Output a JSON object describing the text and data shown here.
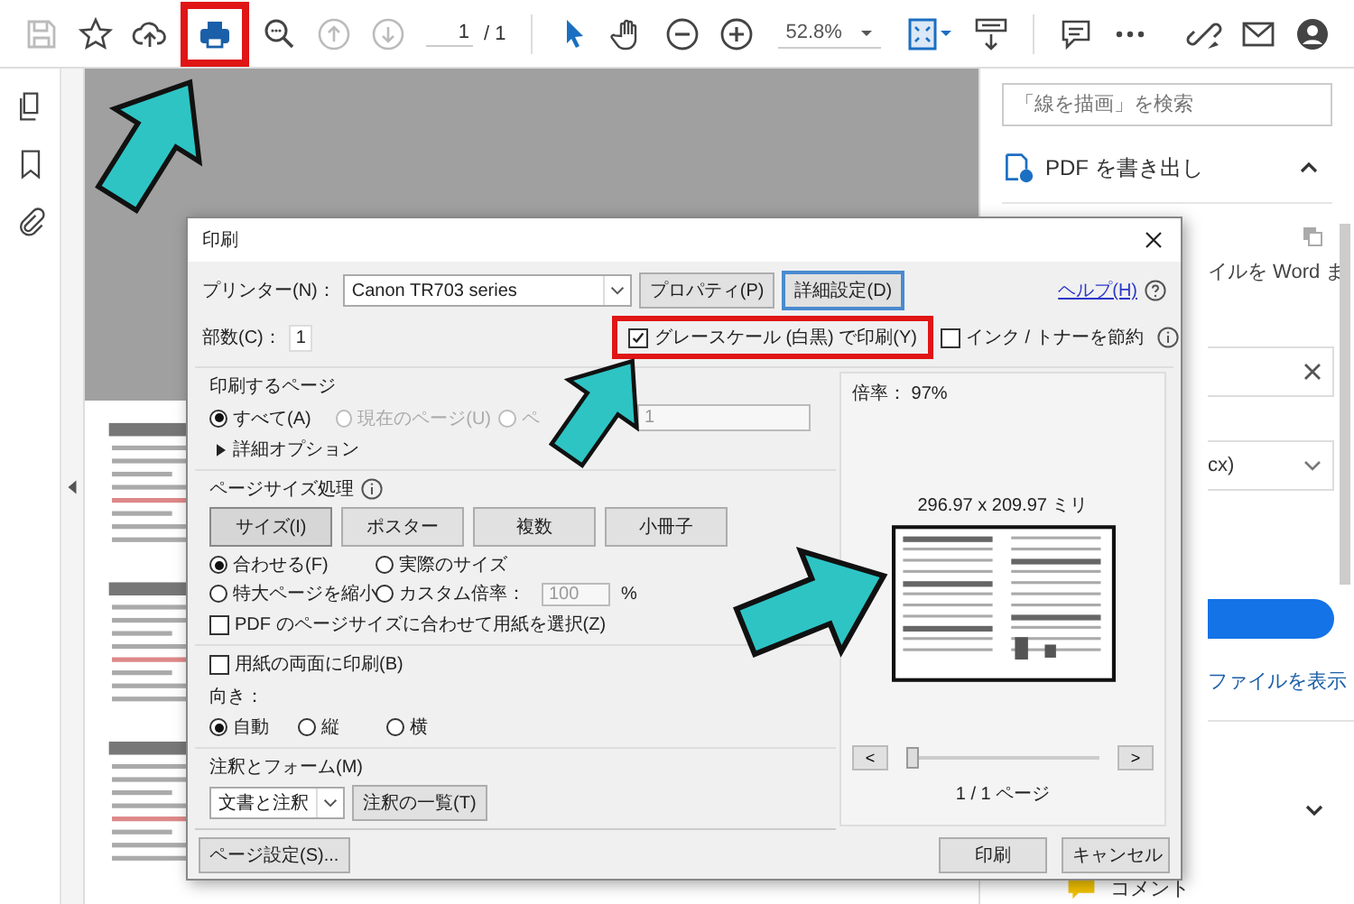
{
  "toolbar": {
    "print_highlighted": true,
    "page_current": "1",
    "page_total": "/ 1",
    "zoom": "52.8%"
  },
  "right_panel": {
    "search_placeholder": "「線を描画」を検索",
    "export_title": "PDF を書き出し",
    "description": "イルを Word ま",
    "format_value": "cx)",
    "view_link": "ファイルを表示",
    "comment_label": "コメント"
  },
  "dialog": {
    "title": "印刷",
    "printer_label": "プリンター(N)：",
    "printer_value": "Canon TR703 series",
    "properties_button": "プロパティ(P)",
    "advanced_button": "詳細設定(D)",
    "help_link": "ヘルプ(H)",
    "copies_label": "部数(C)：",
    "copies_value": "1",
    "grayscale": {
      "label": "グレースケール (白黒) で印刷(Y)",
      "checked": true,
      "highlighted": true
    },
    "save_ink": {
      "label": "インク / トナーを節約",
      "checked": false
    },
    "pages": {
      "title": "印刷するページ",
      "options": [
        {
          "label": "すべて(A)",
          "selected": true,
          "disabled": false
        },
        {
          "label": "現在のページ(U)",
          "selected": false,
          "disabled": true
        },
        {
          "label": "ペ",
          "selected": false,
          "disabled": true
        }
      ],
      "range_value": "1",
      "more_options": "詳細オプション"
    },
    "page_size": {
      "title": "ページサイズ処理",
      "tabs": [
        {
          "label": "サイズ(I)",
          "selected": true
        },
        {
          "label": "ポスター",
          "selected": false
        },
        {
          "label": "複数",
          "selected": false
        },
        {
          "label": "小冊子",
          "selected": false
        }
      ],
      "scaling": [
        {
          "label": "合わせる(F)",
          "selected": true
        },
        {
          "label": "実際のサイズ",
          "selected": false
        },
        {
          "label": "特大ページを縮小",
          "selected": false
        },
        {
          "label": "カスタム倍率：",
          "selected": false
        }
      ],
      "custom_value": "100",
      "percent": "%",
      "paper_by_pdf": {
        "label": "PDF のページサイズに合わせて用紙を選択(Z)",
        "checked": false
      }
    },
    "duplex": {
      "label": "用紙の両面に印刷(B)",
      "checked": false
    },
    "orientation": {
      "label": "向き：",
      "options": [
        {
          "label": "自動",
          "selected": true
        },
        {
          "label": "縦",
          "selected": false
        },
        {
          "label": "横",
          "selected": false
        }
      ]
    },
    "comments": {
      "label": "注釈とフォーム(M)",
      "value": "文書と注釈",
      "button": "注釈の一覧(T)"
    },
    "preview": {
      "scale": "倍率： 97%",
      "size": "296.97 x 209.97 ミリ",
      "prev": "<",
      "next": ">",
      "level": 0,
      "page_count": "1 / 1 ページ"
    },
    "page_setup_button": "ページ設定(S)...",
    "print_button": "印刷",
    "cancel_button": "キャンセル"
  }
}
